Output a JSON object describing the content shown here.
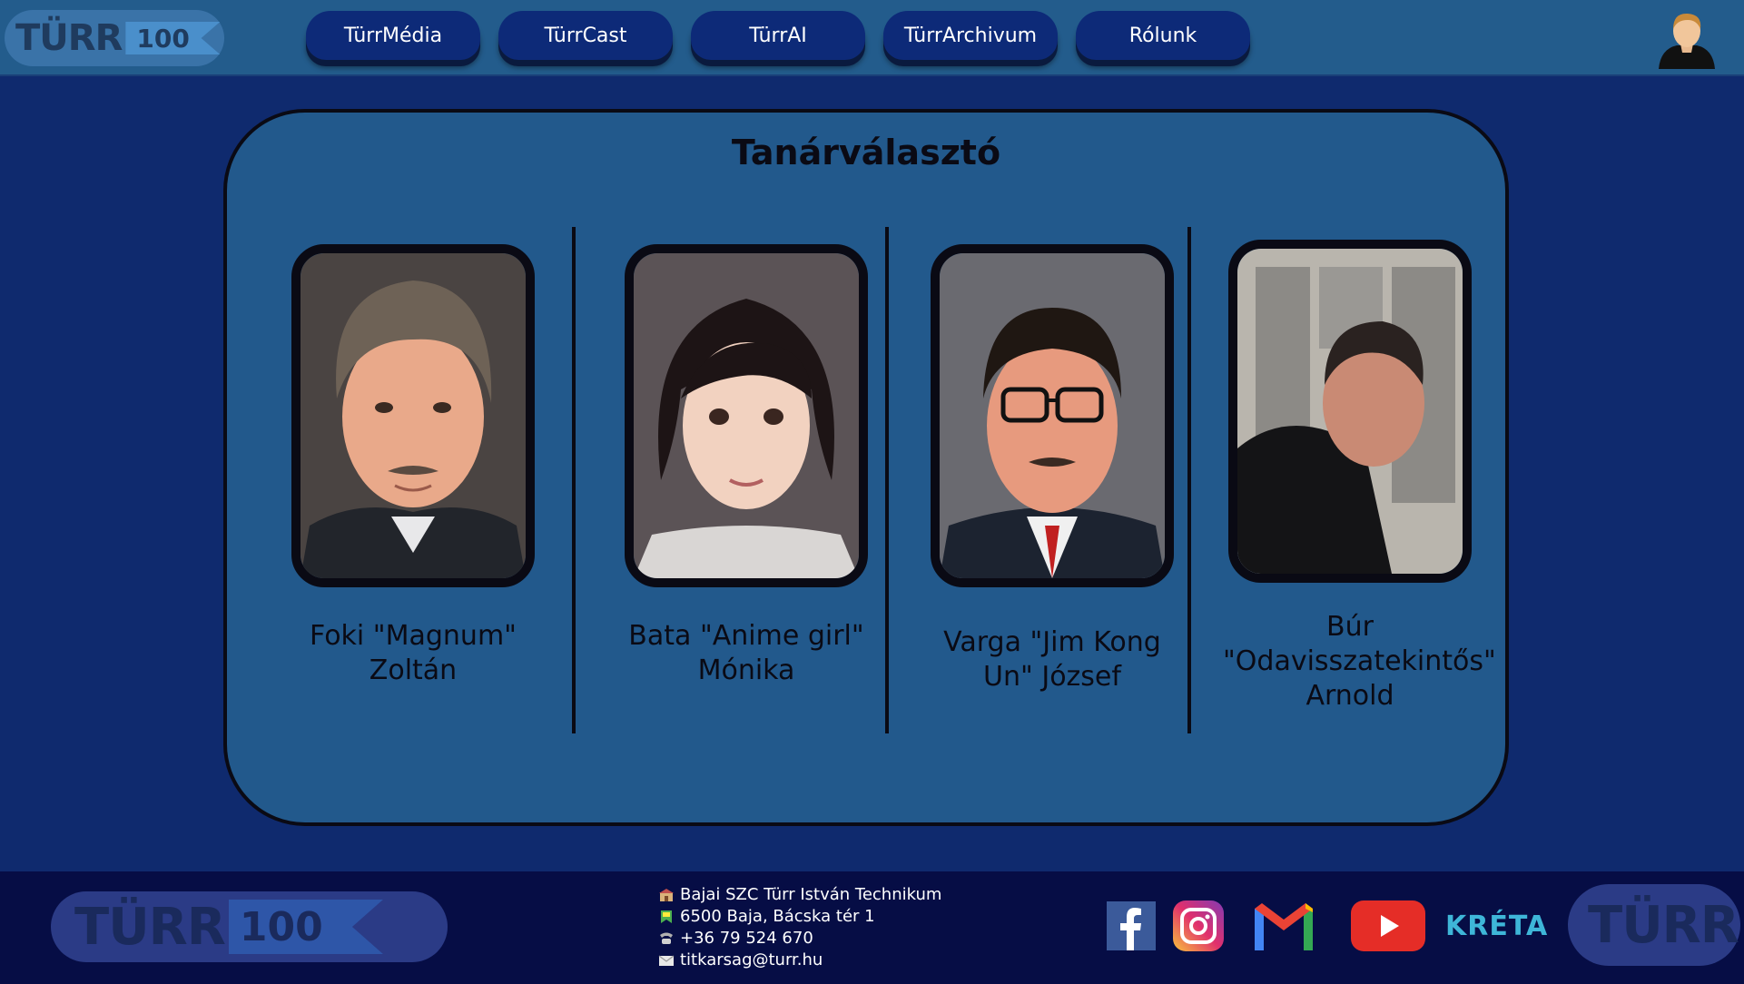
{
  "header": {
    "logo_text": "TÜRR",
    "logo_number": "100",
    "nav": [
      {
        "label": "TürrMédia"
      },
      {
        "label": "TürrCast"
      },
      {
        "label": "TürrAI"
      },
      {
        "label": "TürrArchivum"
      },
      {
        "label": "Rólunk"
      }
    ],
    "avatar_icon": "user-avatar-icon"
  },
  "main": {
    "title": "Tanárválasztó",
    "teachers": [
      {
        "name": "Foki \"Magnum\" Zoltán"
      },
      {
        "name": "Bata \"Anime girl\" Mónika"
      },
      {
        "name": "Varga \"Jim Kong Un\" József"
      },
      {
        "name": "Búr \"Odavisszatekintős\" Arnold"
      }
    ]
  },
  "footer": {
    "logo_text": "TÜRR",
    "logo_number": "100",
    "contact": {
      "school": "Bajai SZC Türr István Technikum",
      "address": "6500 Baja, Bácska tér 1",
      "phone": "+36 79 524 670",
      "email": "titkarsag@turr.hu"
    },
    "socials": {
      "facebook": "facebook-icon",
      "instagram": "instagram-icon",
      "gmail": "gmail-icon",
      "youtube": "youtube-icon",
      "kreta": "KRÉTA"
    },
    "right_logo_text": "TÜRR"
  },
  "colors": {
    "header_bg": "#235c8c",
    "page_bg": "#0f2a6e",
    "card_bg": "#22598c",
    "nav_btn": "#0d2a78",
    "footer_bg": "#060d45"
  }
}
